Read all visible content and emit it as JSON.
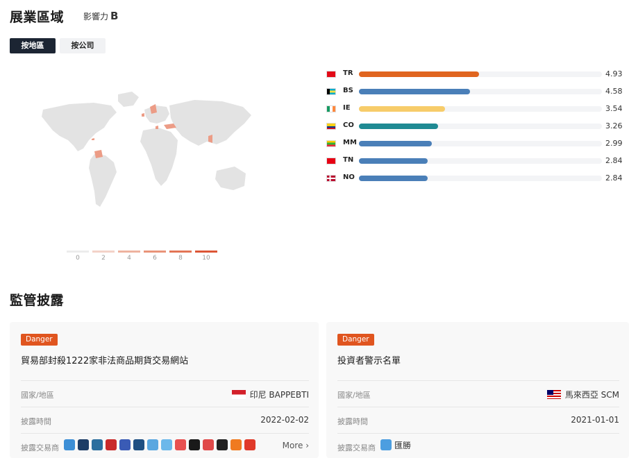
{
  "exhibition": {
    "title": "展業區域",
    "influence_label": "影響力",
    "influence_grade": "B",
    "tabs": [
      "按地區",
      "按公司"
    ]
  },
  "map_legend": [
    "0",
    "2",
    "4",
    "6",
    "8",
    "10"
  ],
  "legend_colors": [
    "#ececec",
    "#f3d2c8",
    "#eeb39f",
    "#e99479",
    "#e37556",
    "#dc5636"
  ],
  "chart_data": {
    "type": "bar",
    "categories": [
      "TR",
      "BS",
      "IE",
      "CO",
      "MM",
      "TN",
      "NO"
    ],
    "values": [
      4.93,
      4.58,
      3.54,
      3.26,
      2.99,
      2.84,
      2.84
    ],
    "colors": [
      "#e0651f",
      "#4a7fb8",
      "#f7cc6a",
      "#1f8a93",
      "#4a7fb8",
      "#4a7fb8",
      "#4a7fb8"
    ],
    "xlim": [
      0,
      10
    ]
  },
  "regulatory": {
    "title": "監管披露",
    "cards": [
      {
        "badge": "Danger",
        "title": "貿易部封殺1222家非法商品期貨交易網站",
        "region_label": "國家/地區",
        "region_value": "印尼 BAPPEBTI",
        "time_label": "披露時間",
        "time_value": "2022-02-02",
        "broker_label": "披露交易商",
        "more": "More"
      },
      {
        "badge": "Danger",
        "title": "投資者警示名單",
        "region_label": "國家/地區",
        "region_value": "馬來西亞 SCM",
        "time_label": "披露時間",
        "time_value": "2021-01-01",
        "broker_label": "披露交易商",
        "broker_name": "匯勝"
      }
    ]
  },
  "broker_icon_colors": [
    "#3d8fd6",
    "#1d3d66",
    "#2c6f9e",
    "#c92a2a",
    "#3a5bb5",
    "#1f4f82",
    "#5aa7e0",
    "#6cb8ea",
    "#e85050",
    "#1a1a1a",
    "#e04a4a",
    "#222222",
    "#f07a20",
    "#e03a2a"
  ]
}
